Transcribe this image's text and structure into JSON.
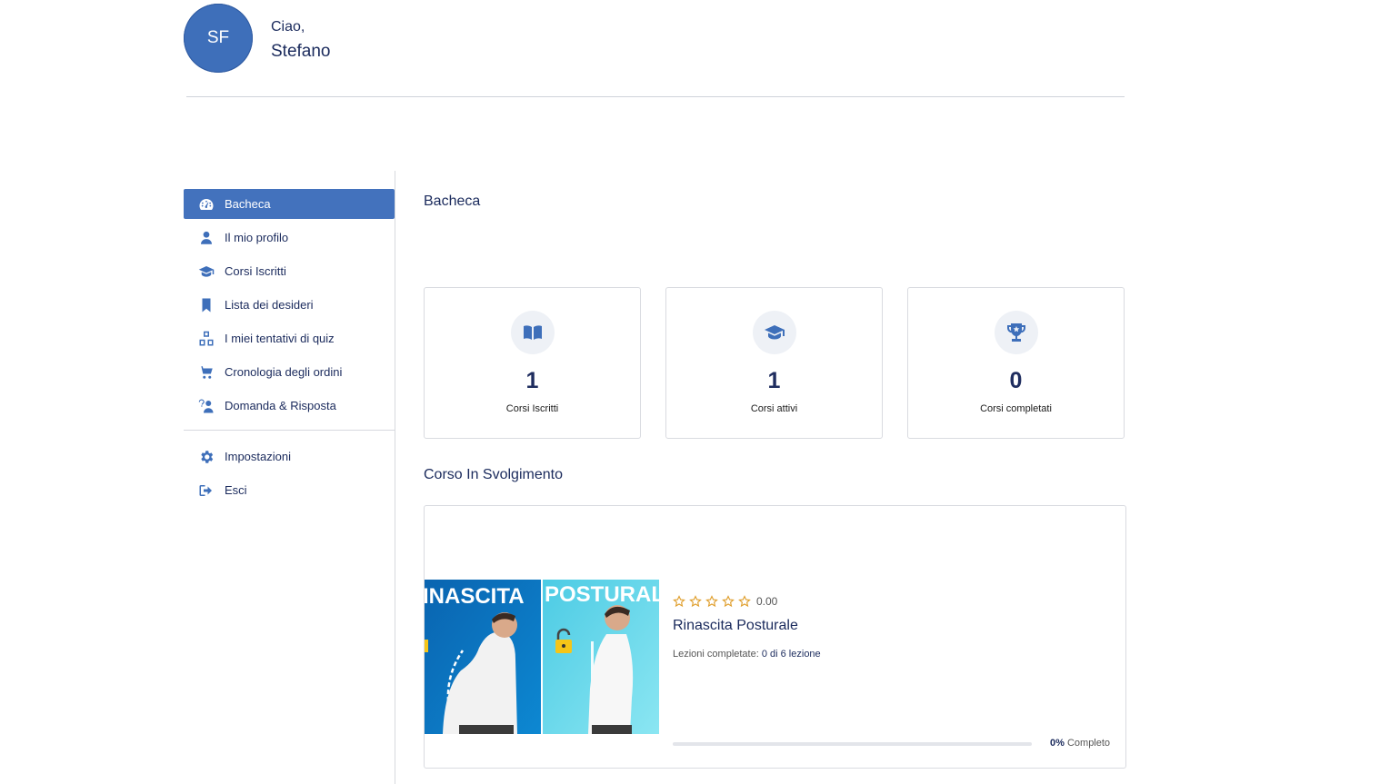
{
  "header": {
    "avatar_initials": "SF",
    "greeting": "Ciao,",
    "user_name": "Stefano"
  },
  "sidebar": {
    "items": [
      {
        "label": "Bacheca",
        "icon": "dashboard-gauge-icon",
        "active": true
      },
      {
        "label": "Il mio profilo",
        "icon": "user-icon"
      },
      {
        "label": "Corsi Iscritti",
        "icon": "graduation-cap-icon"
      },
      {
        "label": "Lista dei desideri",
        "icon": "bookmark-icon"
      },
      {
        "label": "I miei tentativi di quiz",
        "icon": "quiz-blocks-icon"
      },
      {
        "label": "Cronologia degli ordini",
        "icon": "cart-icon"
      },
      {
        "label": "Domanda & Risposta",
        "icon": "question-answer-icon"
      }
    ],
    "bottom_items": [
      {
        "label": "Impostazioni",
        "icon": "gear-icon"
      },
      {
        "label": "Esci",
        "icon": "logout-icon"
      }
    ]
  },
  "main": {
    "title": "Bacheca",
    "stats": [
      {
        "value": "1",
        "label": "Corsi Iscritti",
        "icon": "open-book-icon"
      },
      {
        "value": "1",
        "label": "Corsi attivi",
        "icon": "graduation-cap-icon"
      },
      {
        "value": "0",
        "label": "Corsi completati",
        "icon": "trophy-icon"
      }
    ],
    "in_progress_title": "Corso In Svolgimento",
    "course": {
      "title": "Rinascita Posturale",
      "rating": "0.00",
      "stars": 0,
      "lessons_label": "Lezioni completate:",
      "lessons_value": "0 di 6 lezione",
      "progress_fraction": 0,
      "progress_percent": "0%",
      "progress_suffix": "Completo",
      "thumbnail_text_left": "INASCITA",
      "thumbnail_text_right": "POSTURAL"
    }
  },
  "colors": {
    "accent": "#4372bd",
    "text": "#1a2a5c",
    "star": "#e0a030",
    "thumb_left": "#0a76c2",
    "thumb_right": "#5dd3e6"
  }
}
